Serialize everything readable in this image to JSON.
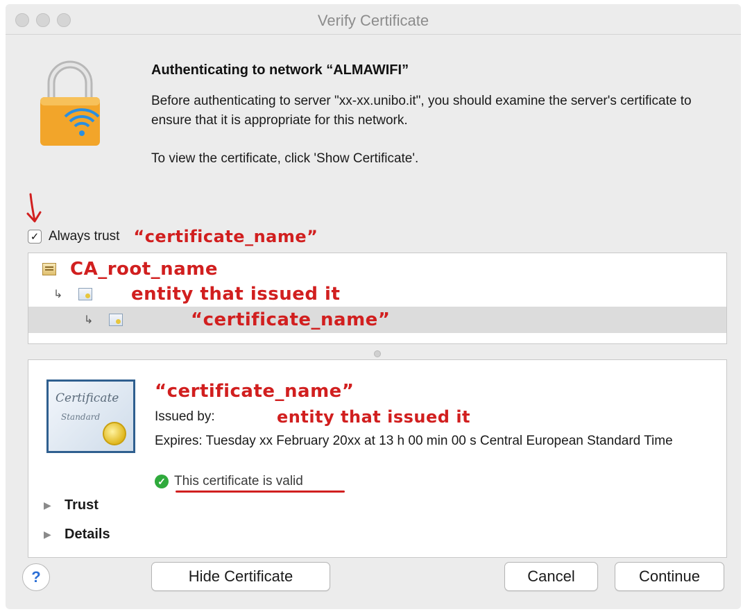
{
  "window": {
    "title": "Verify Certificate"
  },
  "auth": {
    "title": "Authenticating to network “ALMAWIFI”",
    "body": "Before authenticating to server \"xx-xx.unibo.it\", you should examine the server's certificate to ensure that it is appropriate for this network.",
    "hint": "To view the certificate, click 'Show Certificate'."
  },
  "trust_checkbox": {
    "checked": true,
    "label": "Always trust",
    "annotation": "“certificate_name”"
  },
  "chain": [
    {
      "label": "CA_root_name",
      "level": 0,
      "selected": false
    },
    {
      "label": "entity that issued it",
      "level": 1,
      "selected": false
    },
    {
      "label": "“certificate_name”",
      "level": 2,
      "selected": true
    }
  ],
  "detail": {
    "icon_text_1": "Certificate",
    "icon_text_2": "Standard",
    "name": "“certificate_name”",
    "issued_by_label": "Issued by:",
    "issued_by_value": "entity that issued it",
    "expires": "Expires: Tuesday xx February 20xx at 13 h 00 min 00 s Central European Standard Time",
    "status": "This certificate is valid",
    "status_color": "#2faa3c",
    "disclosures": {
      "trust": "Trust",
      "details": "Details"
    }
  },
  "buttons": {
    "help": "?",
    "hide_certificate": "Hide Certificate",
    "cancel": "Cancel",
    "continue": "Continue"
  },
  "colors": {
    "annotation_red": "#d11f1f",
    "window_bg": "#ececec",
    "help_blue": "#2b6fd6"
  },
  "icons": {
    "lock": "lock-wifi-icon",
    "arrow": "red-arrow-annotation",
    "tree_arrow": "↳",
    "disclosure": "▶",
    "check": "✓"
  }
}
